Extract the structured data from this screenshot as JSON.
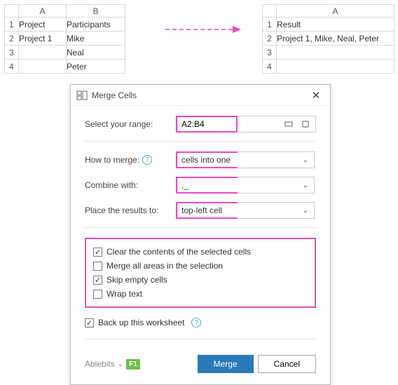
{
  "left_grid": {
    "columns": [
      "A",
      "B"
    ],
    "rows": [
      "1",
      "2",
      "3",
      "4"
    ],
    "data": [
      [
        "Project",
        "Participants"
      ],
      [
        "Project 1",
        "Mike"
      ],
      [
        "",
        "Neal"
      ],
      [
        "",
        "Peter"
      ]
    ]
  },
  "right_grid": {
    "columns": [
      "A"
    ],
    "rows": [
      "1",
      "2",
      "3",
      "4"
    ],
    "data": [
      [
        "Result"
      ],
      [
        "Project 1, Mike, Neal, Peter"
      ],
      [
        ""
      ],
      [
        ""
      ]
    ]
  },
  "dialog": {
    "title": "Merge Cells",
    "labels": {
      "select_range": "Select your range:",
      "how_merge": "How to merge:",
      "combine_with": "Combine with:",
      "place_results": "Place the results to:"
    },
    "values": {
      "range": "A2:B4",
      "how_merge": "cells into one",
      "combine_with": ",_",
      "place_results": "top-left cell"
    },
    "checkboxes": {
      "clear": {
        "label": "Clear the contents of the selected cells",
        "checked": true
      },
      "merge_all": {
        "label": "Merge all areas in the selection",
        "checked": false
      },
      "skip_empty": {
        "label": "Skip empty cells",
        "checked": true
      },
      "wrap": {
        "label": "Wrap text",
        "checked": false
      },
      "backup": {
        "label": "Back up this worksheet",
        "checked": true
      }
    },
    "brand": "Ablebits",
    "f1": "F1",
    "buttons": {
      "merge": "Merge",
      "cancel": "Cancel"
    }
  }
}
